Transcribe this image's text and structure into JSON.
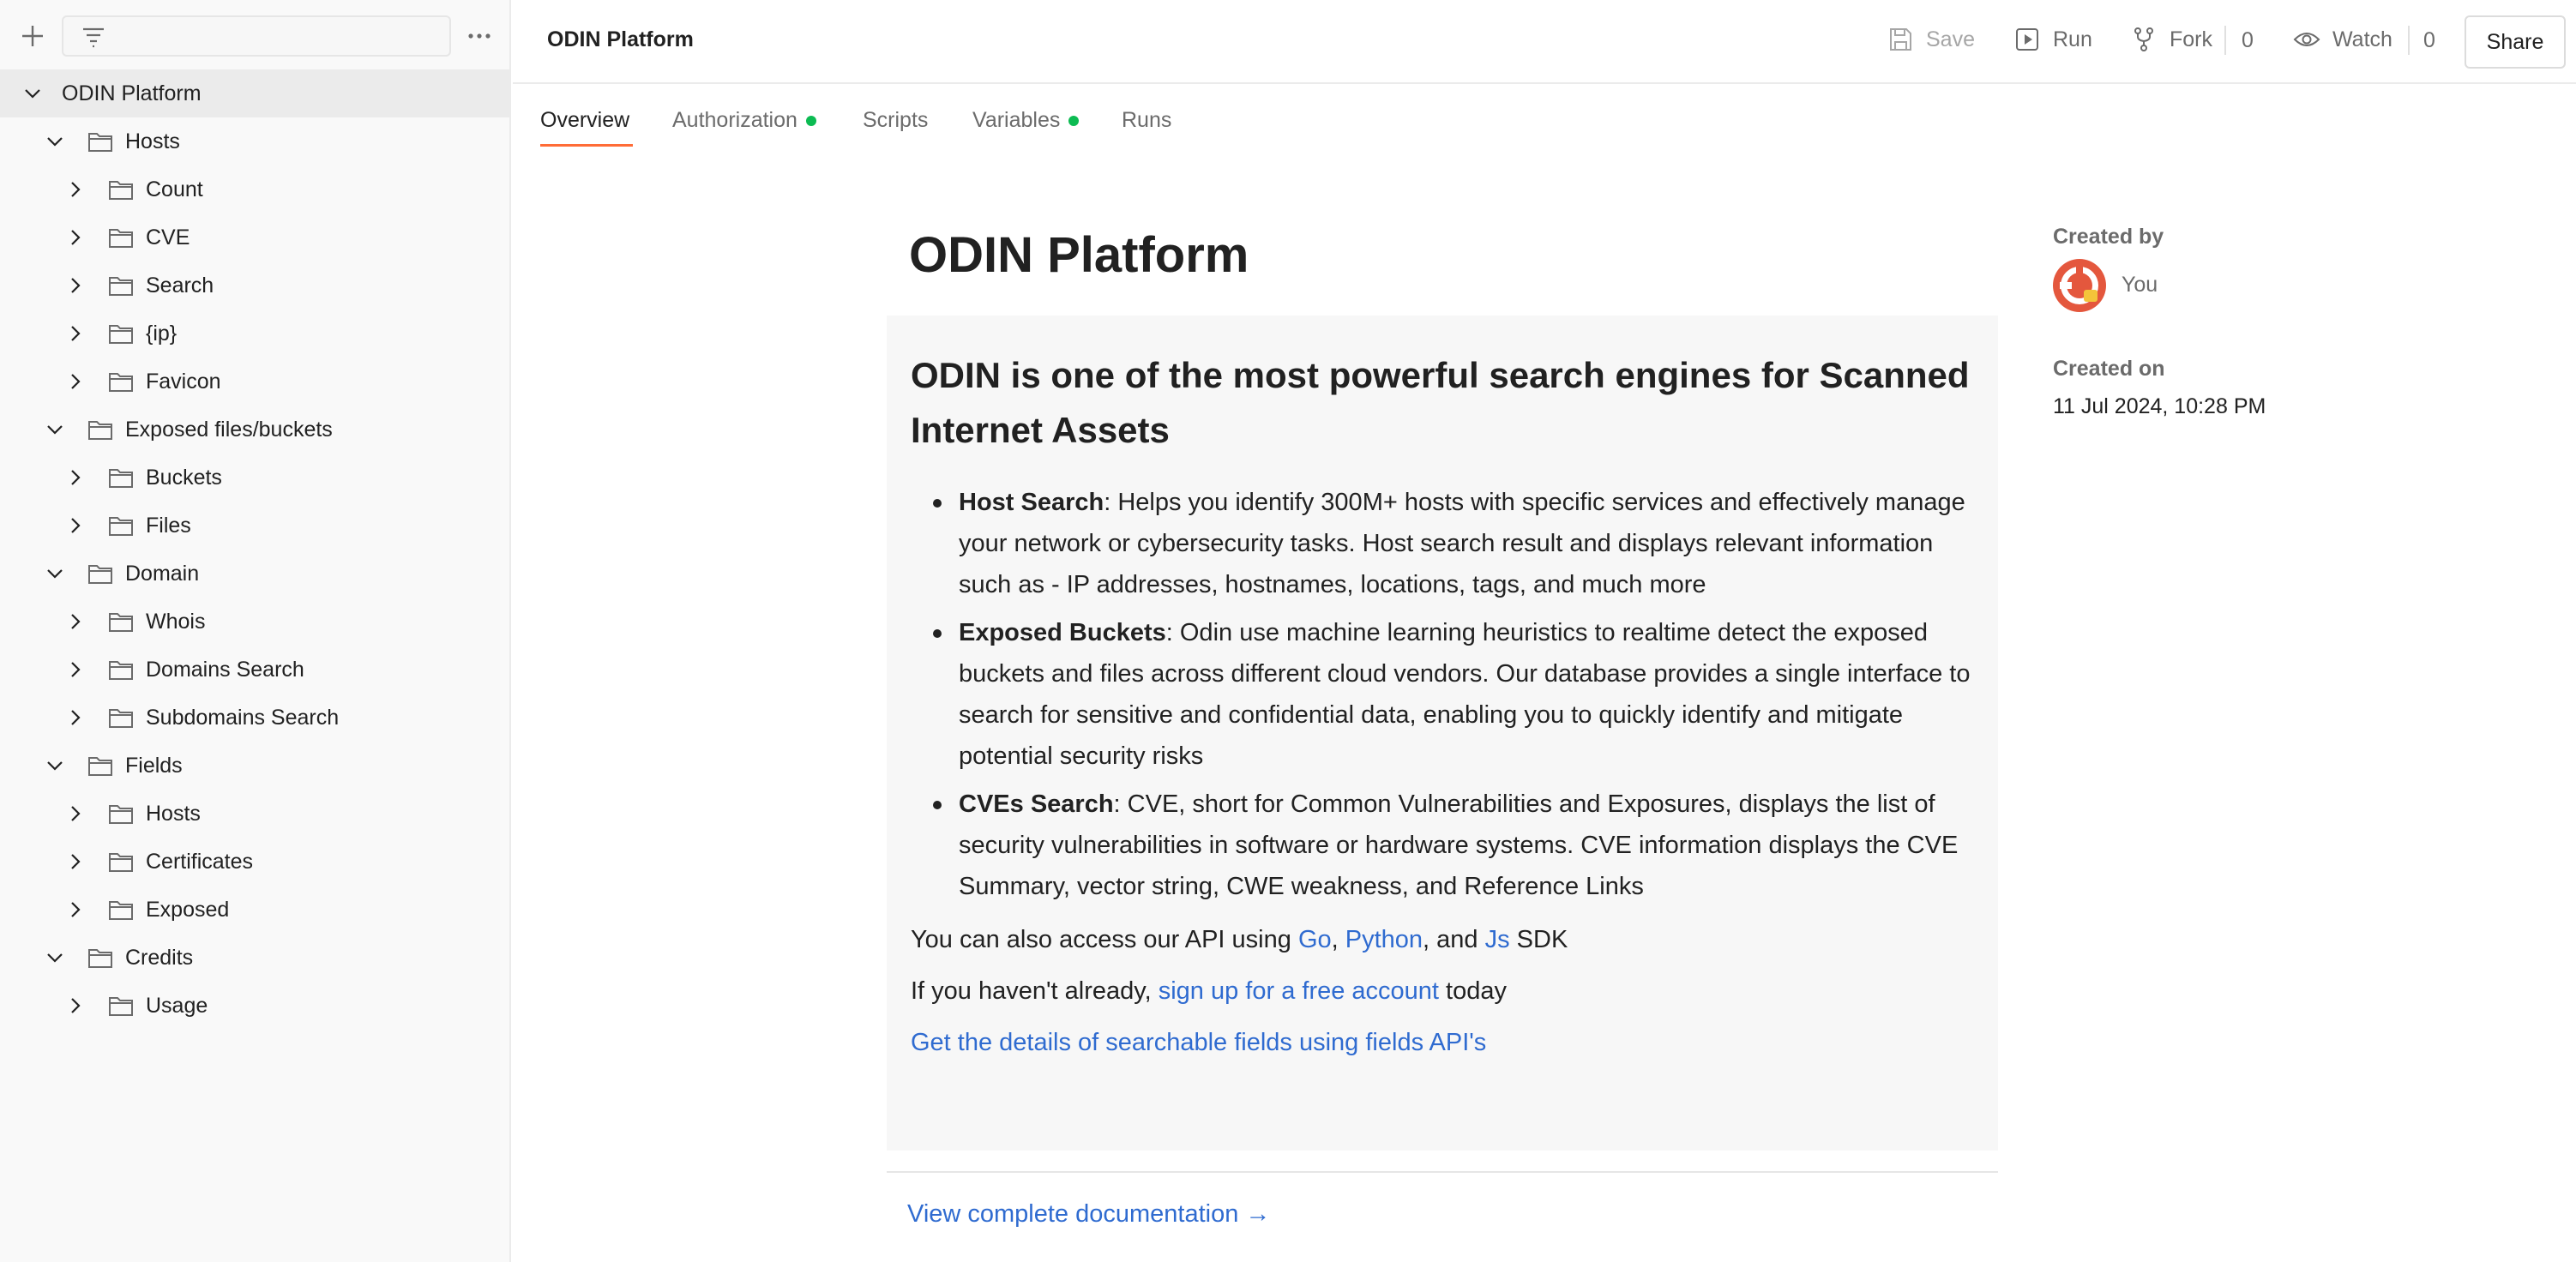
{
  "sidebar": {
    "filter_placeholder": "",
    "tree": [
      {
        "label": "ODIN Platform"
      },
      {
        "label": "Hosts"
      },
      {
        "label": "Count"
      },
      {
        "label": "CVE"
      },
      {
        "label": "Search"
      },
      {
        "label": "{ip}"
      },
      {
        "label": "Favicon"
      },
      {
        "label": "Exposed files/buckets"
      },
      {
        "label": "Buckets"
      },
      {
        "label": "Files"
      },
      {
        "label": "Domain"
      },
      {
        "label": "Whois"
      },
      {
        "label": "Domains Search"
      },
      {
        "label": "Subdomains Search"
      },
      {
        "label": "Fields"
      },
      {
        "label": "Hosts"
      },
      {
        "label": "Certificates"
      },
      {
        "label": "Exposed"
      },
      {
        "label": "Credits"
      },
      {
        "label": "Usage"
      }
    ]
  },
  "header": {
    "title": "ODIN Platform",
    "save_label": "Save",
    "run_label": "Run",
    "fork_label": "Fork",
    "fork_count": "0",
    "watch_label": "Watch",
    "watch_count": "0",
    "share_label": "Share"
  },
  "tabs": [
    {
      "label": "Overview"
    },
    {
      "label": "Authorization"
    },
    {
      "label": "Scripts"
    },
    {
      "label": "Variables"
    },
    {
      "label": "Runs"
    }
  ],
  "overview": {
    "title": "ODIN Platform",
    "heading": "ODIN is one of the most powerful search engines for Scanned Internet Assets",
    "bullets": [
      {
        "bold": "Host Search",
        "text": ": Helps you identify 300M+ hosts with specific services and effectively manage your network or cybersecurity tasks. Host search result and displays relevant information such as - IP addresses, hostnames, locations, tags, and much more"
      },
      {
        "bold": "Exposed Buckets",
        "text": ": Odin use machine learning heuristics to realtime detect the exposed buckets and files across different cloud vendors. Our database provides a single interface to search for sensitive and confidential data, enabling you to quickly identify and mitigate potential security risks"
      },
      {
        "bold": "CVEs Search",
        "text": ": CVE, short for Common Vulnerabilities and Exposures, displays the list of security vulnerabilities in software or hardware systems. CVE information displays the CVE Summary, vector string, CWE weakness, and Reference Links"
      }
    ],
    "api_prefix": "You can also access our API using ",
    "api_go": "Go",
    "api_comma": ", ",
    "api_python": "Python",
    "api_and": ", and ",
    "api_js": "Js",
    "api_suffix": " SDK",
    "signup_prefix": "If you haven't already, ",
    "signup_link": "sign up for a free account",
    "signup_suffix": " today",
    "fields_link": "Get the details of searchable fields using fields API's",
    "doc_link": "View complete documentation →"
  },
  "meta": {
    "created_by_label": "Created by",
    "created_by_value": "You",
    "created_on_label": "Created on",
    "created_on_value": "11 Jul 2024, 10:28 PM"
  },
  "colors": {
    "accent": "#ff6c37",
    "link": "#2f6bd0",
    "status_dot": "#0cbb52"
  }
}
